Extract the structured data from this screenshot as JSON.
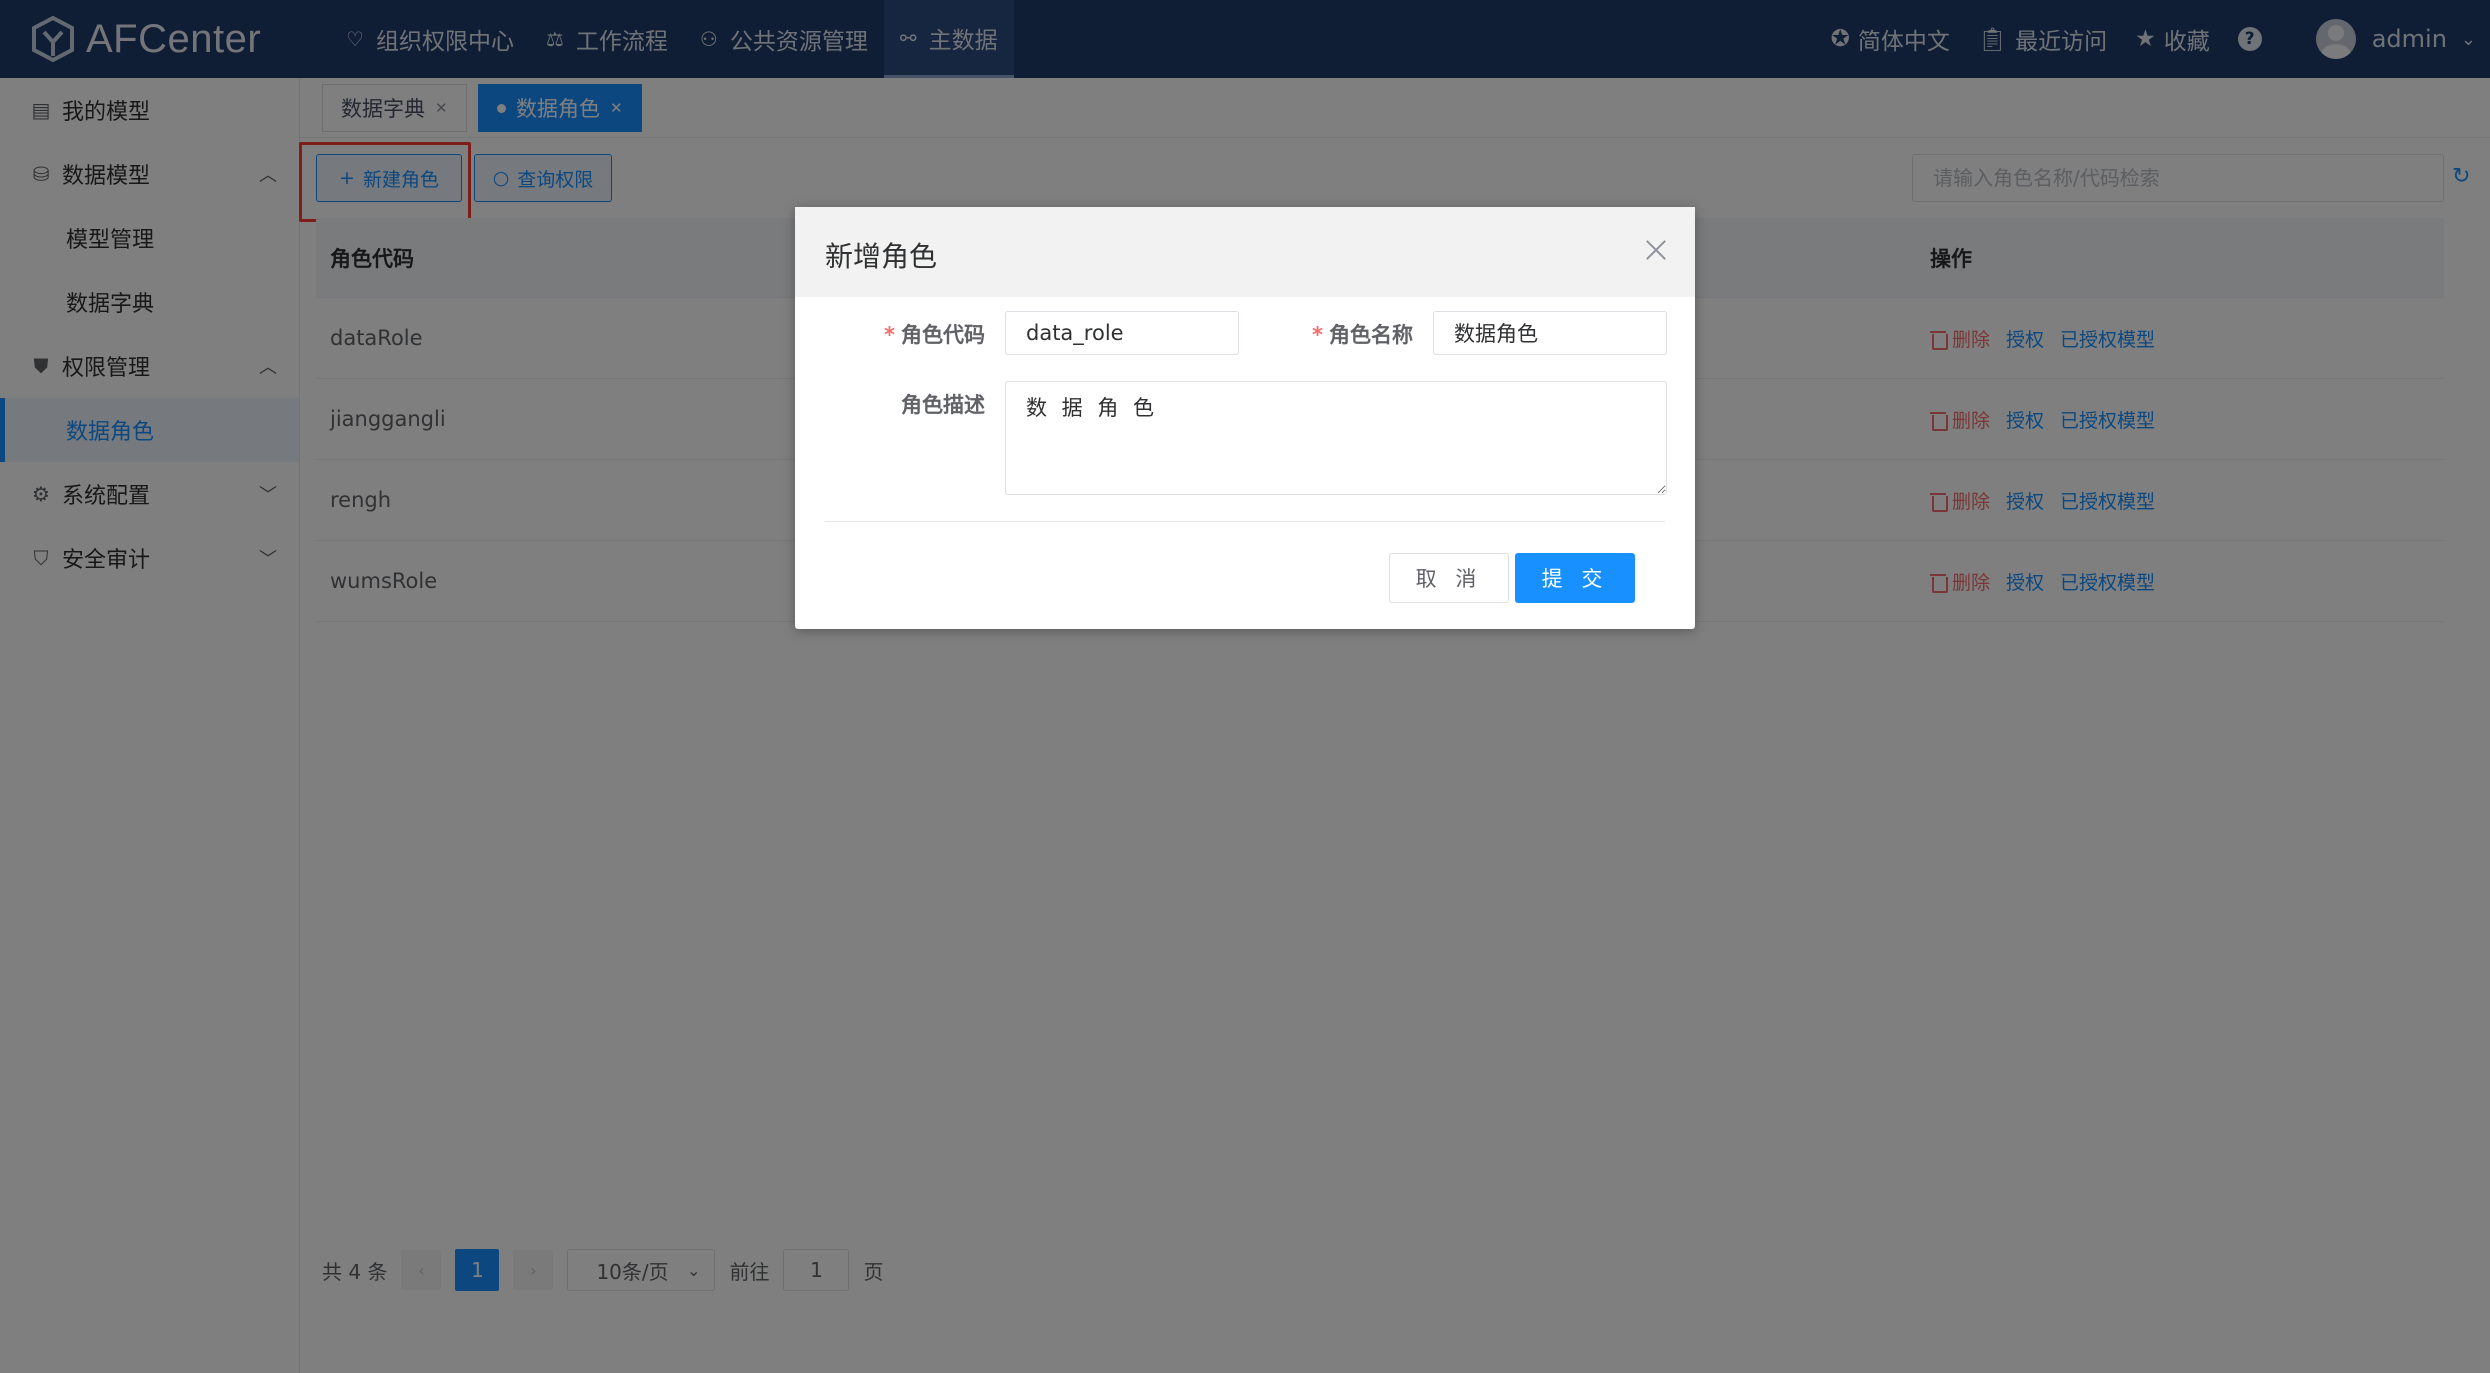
{
  "app": {
    "logo_text": "AFCenter",
    "nav": [
      {
        "label": "组织权限中心",
        "icon": "shield-heart-icon"
      },
      {
        "label": "工作流程",
        "icon": "workflow-icon"
      },
      {
        "label": "公共资源管理",
        "icon": "people-icon"
      },
      {
        "label": "主数据",
        "icon": "master-data-icon"
      }
    ],
    "right": {
      "language": "简体中文",
      "recent": "最近访问",
      "favorites": "收藏",
      "user": "admin"
    }
  },
  "sidebar": {
    "items": [
      {
        "label": "我的模型",
        "icon": "model-icon"
      },
      {
        "label": "数据模型",
        "icon": "data-model-icon"
      },
      {
        "label": "模型管理"
      },
      {
        "label": "数据字典"
      },
      {
        "label": "权限管理",
        "icon": "shield-icon"
      },
      {
        "label": "数据角色"
      },
      {
        "label": "系统配置",
        "icon": "settings-icon"
      },
      {
        "label": "安全审计",
        "icon": "audit-icon"
      }
    ]
  },
  "tabs": [
    {
      "label": "数据字典"
    },
    {
      "label": "数据角色"
    }
  ],
  "toolbar": {
    "new_role": "新建角色",
    "query_permission": "查询权限",
    "search_placeholder": "请输入角色名称/代码检索"
  },
  "table": {
    "headers": {
      "code": "角色代码",
      "ops": "操作"
    },
    "rows": [
      {
        "code": "dataRole"
      },
      {
        "code": "jianggangli"
      },
      {
        "code": "rengh"
      },
      {
        "code": "wumsRole"
      }
    ],
    "ops": {
      "delete": "删除",
      "grant": "授权",
      "granted_models": "已授权模型"
    }
  },
  "pagination": {
    "total": "共 4 条",
    "current": "1",
    "page_size": "10条/页",
    "goto": "前往",
    "goto_value": "1",
    "page": "页"
  },
  "dialog": {
    "title": "新增角色",
    "code_label": "角色代码",
    "code_value": "data_role",
    "name_label": "角色名称",
    "name_value": "数据角色",
    "desc_label": "角色描述",
    "desc_value": "数 据 角 色",
    "cancel": "取 消",
    "submit": "提 交"
  },
  "colors": {
    "topbar": "#1e3a6b",
    "primary": "#1890ff",
    "danger": "#f56c6c",
    "highlight": "#ff3b30"
  }
}
